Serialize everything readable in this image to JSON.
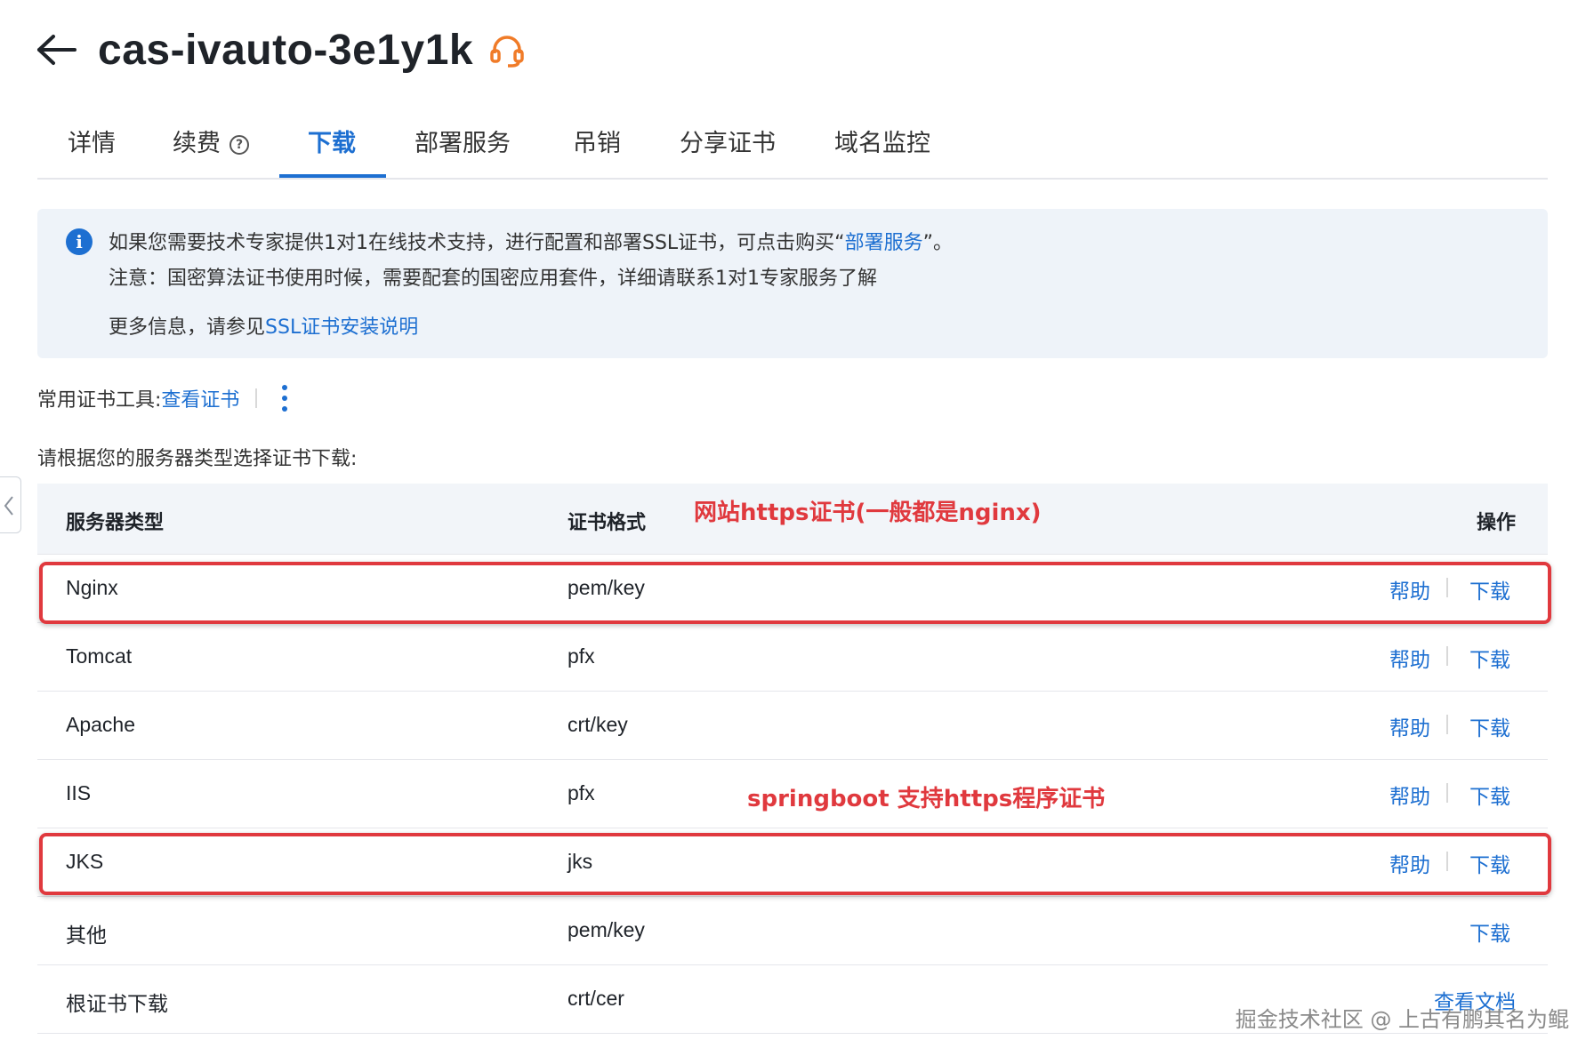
{
  "header": {
    "title": "cas-ivauto-3e1y1k",
    "back_icon": "arrow-left-icon",
    "support_icon": "headset-icon"
  },
  "tabs": [
    {
      "label": "详情"
    },
    {
      "label": "续费"
    },
    {
      "label": "下载",
      "active": true
    },
    {
      "label": "部署服务"
    },
    {
      "label": "吊销"
    },
    {
      "label": "分享证书"
    },
    {
      "label": "域名监控"
    }
  ],
  "info": {
    "line1_prefix": "如果您需要技术专家提供1对1在线技术支持，进行配置和部署SSL证书，可点击购买“",
    "line1_link": "部署服务",
    "line1_suffix": "”。",
    "line2": "注意：国密算法证书使用时候，需要配套的国密应用套件，详细请联系1对1专家服务了解",
    "line3_prefix": "更多信息，请参见",
    "line3_link": "SSL证书安装说明"
  },
  "tools": {
    "label": "常用证书工具: ",
    "link": "查看证书"
  },
  "prompt": "请根据您的服务器类型选择证书下载:",
  "table": {
    "headers": {
      "server_type": "服务器类型",
      "cert_format": "证书格式",
      "actions": "操作"
    },
    "rows": [
      {
        "server": "Nginx",
        "format": "pem/key",
        "help": "帮助",
        "download": "下载"
      },
      {
        "server": "Tomcat",
        "format": "pfx",
        "help": "帮助",
        "download": "下载"
      },
      {
        "server": "Apache",
        "format": "crt/key",
        "help": "帮助",
        "download": "下载"
      },
      {
        "server": "IIS",
        "format": "pfx",
        "help": "帮助",
        "download": "下载"
      },
      {
        "server": "JKS",
        "format": "jks",
        "help": "帮助",
        "download": "下载"
      },
      {
        "server": "其他",
        "format": "pem/key",
        "download": "下载"
      },
      {
        "server": "根证书下载",
        "format": "crt/cer",
        "docs": "查看文档"
      }
    ]
  },
  "annotations": {
    "nginx_note": "网站https证书(一般都是nginx)",
    "jks_note": "springboot 支持https程序证书",
    "color": "#e0393e"
  },
  "watermark": "掘金技术社区 @ 上古有鹏其名为鲲",
  "colors": {
    "accent": "#1d6fd1",
    "info_bg": "#eef3f9",
    "header_bg": "#f2f5f9"
  }
}
